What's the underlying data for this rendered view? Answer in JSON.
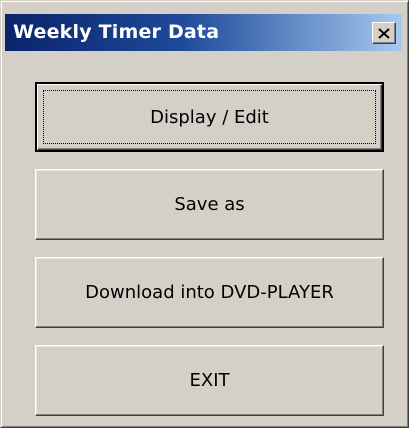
{
  "window": {
    "title": "Weekly Timer Data",
    "close_icon": "close-icon"
  },
  "buttons": {
    "display_edit": "Display / Edit",
    "save_as": "Save as",
    "download": "Download into DVD-PLAYER",
    "exit": "EXIT"
  },
  "colors": {
    "titlebar_start": "#0a246a",
    "titlebar_end": "#a6caf0",
    "face": "#d4d0c8"
  }
}
